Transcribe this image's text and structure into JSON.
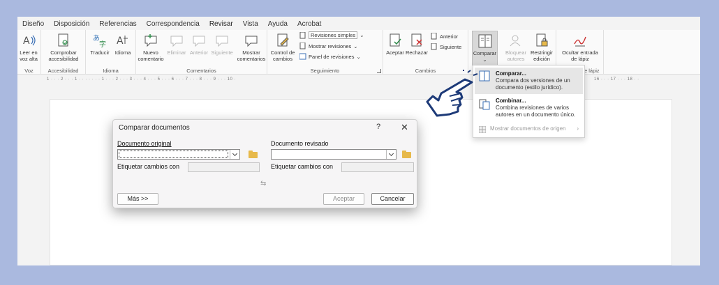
{
  "tabs": [
    "Diseño",
    "Disposición",
    "Referencias",
    "Correspondencia",
    "Revisar",
    "Vista",
    "Ayuda",
    "Acrobat"
  ],
  "active_tab": "Revisar",
  "ribbon": {
    "voz": {
      "read_aloud": "Leer en voz alta",
      "group": "Voz"
    },
    "accesibilidad": {
      "check": "Comprobar accesibilidad",
      "group": "Accesibilidad"
    },
    "idioma": {
      "translate": "Traducir",
      "language": "Idioma",
      "group": "Idioma"
    },
    "comentarios": {
      "new": "Nuevo comentario",
      "delete": "Eliminar",
      "previous": "Anterior",
      "next": "Siguiente",
      "show": "Mostrar comentarios",
      "group": "Comentarios"
    },
    "seguimiento": {
      "track": "Control de cambios",
      "simple": "Revisiones simples",
      "show_markup": "Mostrar revisiones",
      "pane": "Panel de revisiones",
      "group": "Seguimiento"
    },
    "cambios": {
      "accept": "Aceptar",
      "reject": "Rechazar",
      "previous": "Anterior",
      "next": "Siguiente",
      "group": "Cambios"
    },
    "comparar": {
      "compare": "Comparar"
    },
    "proteger": {
      "block": "Bloquear autores",
      "restrict": "Restringir edición"
    },
    "lapiz": {
      "hide_ink": "Ocultar entrada de lápiz",
      "group_partial": "e lápiz"
    }
  },
  "ruler": "1 · · · 2 · · · 1 · · · · · · · 1 · · · 2 · · · 3 · · · 4 · · · 5 · · · 6 · · · 7 · · · 8 · · · 9 · · · 10 ·",
  "ruler_right": "16 · · · 17 · · · 18 · ·",
  "compare_menu": {
    "items": [
      {
        "title": "Comparar...",
        "desc": "Compara dos versiones de un documento (estilo jurídico)."
      },
      {
        "title": "Combinar...",
        "desc": "Combina revisiones de varios autores en un documento único."
      },
      {
        "title": "Mostrar documentos de origen",
        "desc": ""
      }
    ]
  },
  "dialog": {
    "title": "Comparar documentos",
    "help": "?",
    "close": "✕",
    "original_label": "Documento original",
    "revised_label": "Documento revisado",
    "tag_label_left": "Etiquetar cambios con",
    "tag_label_right": "Etiquetar cambios con",
    "more_button": "Más >>",
    "accept_button": "Aceptar",
    "cancel_button": "Cancelar",
    "swap": "⇆"
  },
  "colors": {
    "background": "#aab9df",
    "accent": "#2f6f3a",
    "folder": "#e7b94a"
  }
}
